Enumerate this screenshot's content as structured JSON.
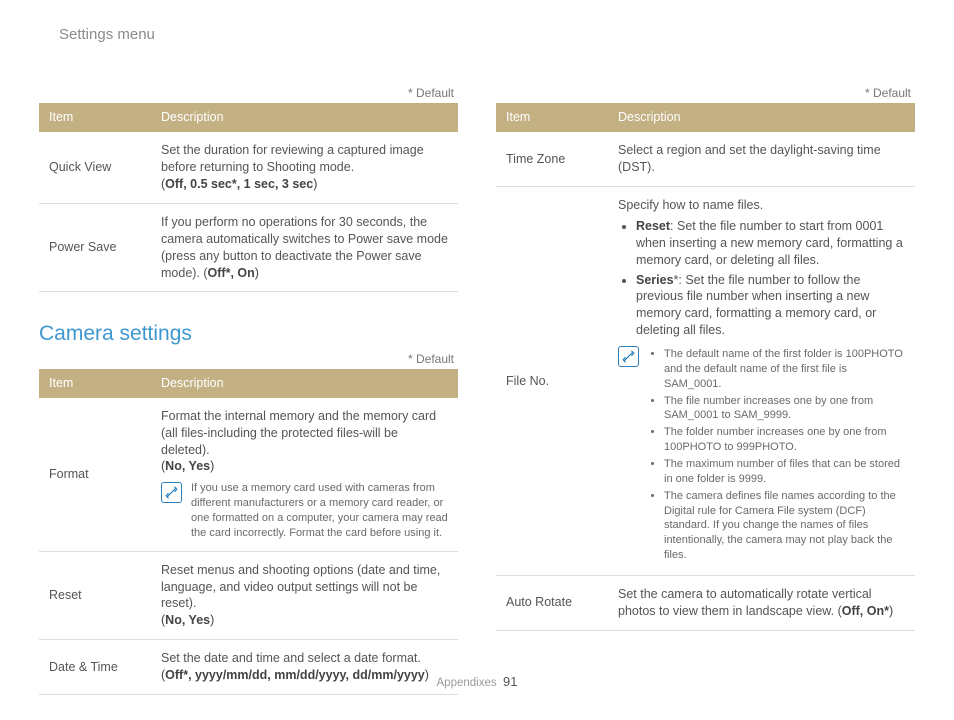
{
  "breadcrumb": "Settings menu",
  "default_label": "* Default",
  "table_headers": {
    "item": "Item",
    "description": "Description"
  },
  "left": {
    "first_table": [
      {
        "item": "Quick View",
        "body": "Set the duration for reviewing a captured image before returning to Shooting mode.",
        "options_prefix": "(",
        "options": "Off, 0.5 sec*, 1 sec, 3 sec",
        "options_suffix": ")"
      },
      {
        "item": "Power Save",
        "body": "If you perform no operations for 30 seconds, the camera automatically switches to Power save mode (press any button to deactivate the Power save mode). (",
        "options": "Off*, On",
        "options_suffix": ")"
      }
    ],
    "section_title": "Camera settings",
    "second_table": [
      {
        "item": "Format",
        "body": "Format the internal memory and the memory card (all files-including the protected files-will be deleted).",
        "options": "No, Yes",
        "note": "If you use a memory card used with cameras from different manufacturers or a memory card reader, or one formatted on a computer, your camera may read the card incorrectly. Format the card before using it."
      },
      {
        "item": "Reset",
        "body": "Reset menus and shooting options (date and time, language, and video output settings will not be reset).",
        "options": "No, Yes"
      },
      {
        "item": "Date & Time",
        "body": "Set the date and time and select a date format.",
        "options": "Off*, yyyy/mm/dd, mm/dd/yyyy, dd/mm/yyyy"
      }
    ]
  },
  "right": {
    "table": {
      "time_zone": {
        "item": "Time Zone",
        "body": "Select a region and set the daylight-saving time (DST)."
      },
      "file_no": {
        "item": "File No.",
        "intro": "Specify how to name files.",
        "b1_head": "Reset",
        "b1_tail": ": Set the file number to start from 0001 when inserting a new memory card, formatting a memory card, or deleting all files.",
        "b2_head": "Series",
        "b2_tail": "*: Set the file number to follow the previous file number when inserting a new memory card, formatting a memory card, or deleting all files.",
        "notes": [
          "The default name of the first folder is 100PHOTO and the default name of the first file is SAM_0001.",
          "The file number increases one by one from SAM_0001 to SAM_9999.",
          "The folder number increases one by one from 100PHOTO to 999PHOTO.",
          "The maximum number of files that can be stored in one folder is 9999.",
          "The camera defines file names according to the Digital rule for Camera File system (DCF) standard. If you change the names of files intentionally, the camera may not play back the files."
        ]
      },
      "auto_rotate": {
        "item": "Auto Rotate",
        "body": "Set the camera to automatically rotate vertical photos to view them in landscape view. (",
        "options": "Off, On*",
        "options_suffix": ")"
      }
    }
  },
  "footer": {
    "section": "Appendixes",
    "page": "91"
  }
}
